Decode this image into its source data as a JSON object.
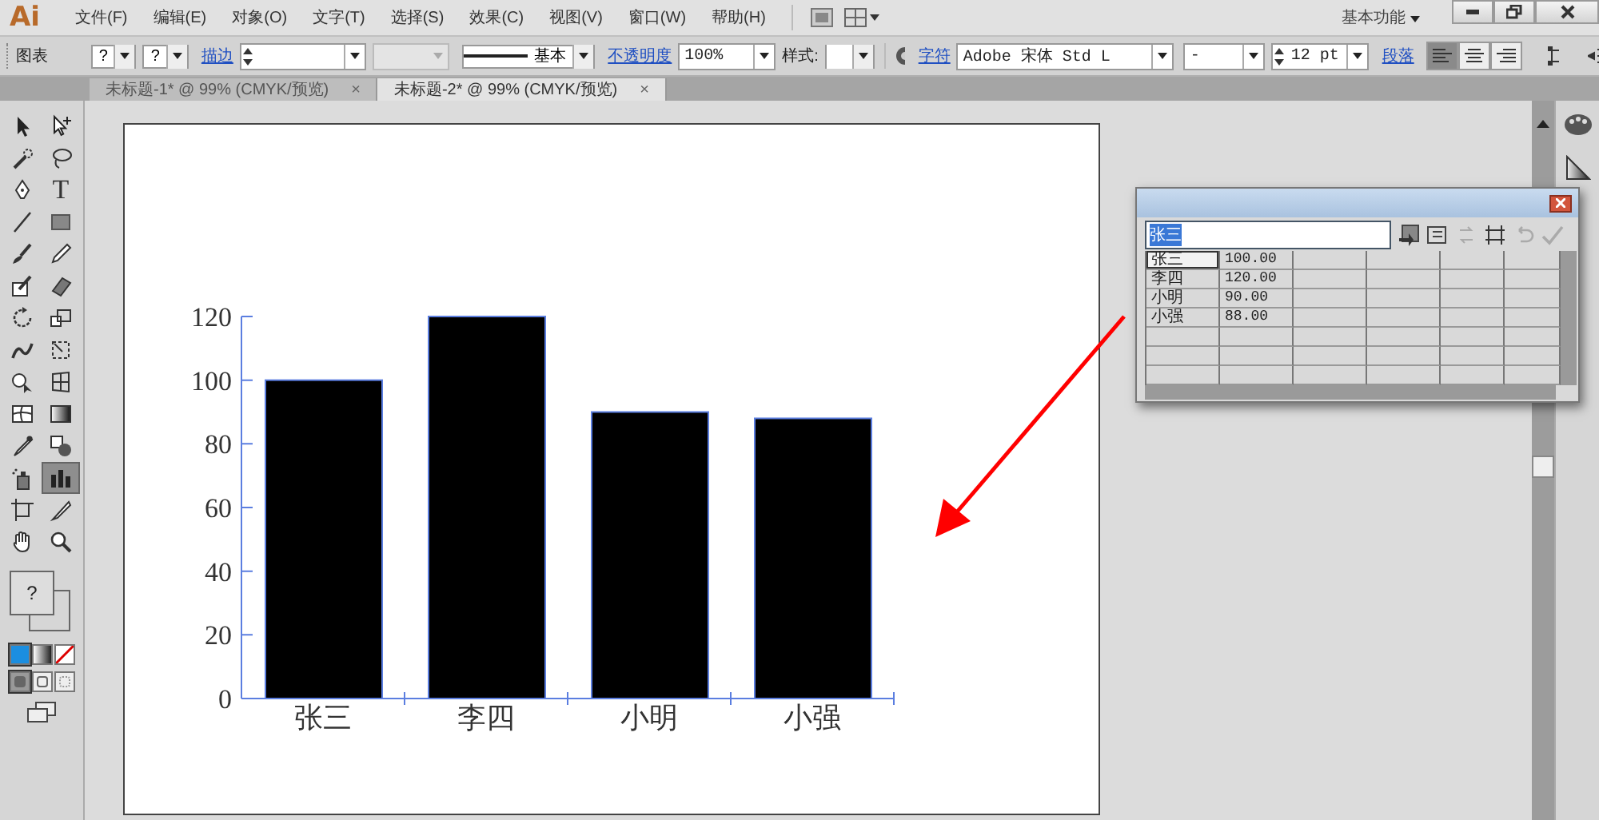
{
  "menu_bar": {
    "logo": "Ai",
    "items": [
      "文件(F)",
      "编辑(E)",
      "对象(O)",
      "文字(T)",
      "选择(S)",
      "效果(C)",
      "视图(V)",
      "窗口(W)",
      "帮助(H)"
    ],
    "workspace": "基本功能"
  },
  "control_bar": {
    "object_type": "图表",
    "fill_value": "?",
    "stroke_value": "?",
    "stroke_link": "描边",
    "stroke_profile": "基本",
    "opacity_link": "不透明度",
    "opacity": "100%",
    "style_label": "样式:",
    "character_link": "字符",
    "font_family": "Adobe 宋体 Std L",
    "font_style": "-",
    "font_size": "12 pt",
    "paragraph_link": "段落",
    "align": [
      {
        "kind": "left",
        "selected": true
      },
      {
        "kind": "center",
        "selected": false
      },
      {
        "kind": "right",
        "selected": false
      }
    ]
  },
  "tabs": [
    {
      "label": "未标题-1* @ 99% (CMYK/预览)",
      "close": "×",
      "selected": false
    },
    {
      "label": "未标题-2* @ 99% (CMYK/预览)",
      "close": "×",
      "selected": true
    }
  ],
  "tools": [
    {
      "kind": "select",
      "selected": false
    },
    {
      "kind": "direct",
      "selected": false
    },
    {
      "kind": "wand",
      "selected": false
    },
    {
      "kind": "lasso",
      "selected": false
    },
    {
      "kind": "pen",
      "selected": false
    },
    {
      "kind": "type",
      "glyph": "T",
      "selected": false
    },
    {
      "kind": "line",
      "selected": false
    },
    {
      "kind": "rect",
      "selected": false
    },
    {
      "kind": "brush",
      "selected": false
    },
    {
      "kind": "pencil",
      "selected": false
    },
    {
      "kind": "blob",
      "selected": false
    },
    {
      "kind": "eraser",
      "selected": false
    },
    {
      "kind": "rotate",
      "selected": false
    },
    {
      "kind": "scale",
      "selected": false
    },
    {
      "kind": "warp",
      "selected": false
    },
    {
      "kind": "free",
      "selected": false
    },
    {
      "kind": "builder",
      "selected": false
    },
    {
      "kind": "perspective",
      "selected": false
    },
    {
      "kind": "mesh",
      "selected": false
    },
    {
      "kind": "gradient",
      "selected": false
    },
    {
      "kind": "eyedropper",
      "selected": false
    },
    {
      "kind": "blend",
      "selected": false
    },
    {
      "kind": "spray",
      "selected": false
    },
    {
      "kind": "graph",
      "selected": true
    },
    {
      "kind": "artboard",
      "selected": false
    },
    {
      "kind": "slice",
      "selected": false
    },
    {
      "kind": "hand",
      "selected": false
    },
    {
      "kind": "zoom",
      "selected": false
    }
  ],
  "fill_stroke": {
    "fill_value": "?"
  },
  "color_modes": [
    {
      "kind": "color",
      "selected": true
    },
    {
      "kind": "gradient",
      "selected": false
    },
    {
      "kind": "none",
      "selected": false
    }
  ],
  "draw_modes": [
    {
      "kind": "normal",
      "selected": true
    },
    {
      "kind": "behind",
      "selected": false
    },
    {
      "kind": "inside",
      "selected": false
    }
  ],
  "artboard": {
    "chart_data": {
      "type": "bar",
      "categories": [
        "张三",
        "李四",
        "小明",
        "小强"
      ],
      "values": [
        100,
        120,
        90,
        88
      ],
      "ylim": [
        0,
        120
      ],
      "yticks": [
        0,
        20,
        40,
        60,
        80,
        100,
        120
      ]
    }
  },
  "data_window": {
    "cell_input": "张三",
    "rows": [
      {
        "name": "张三",
        "value": "100.00",
        "selected": true
      },
      {
        "name": "李四",
        "value": "120.00",
        "selected": false
      },
      {
        "name": "小明",
        "value": "90.00",
        "selected": false
      },
      {
        "name": "小强",
        "value": "88.00",
        "selected": false
      }
    ]
  }
}
